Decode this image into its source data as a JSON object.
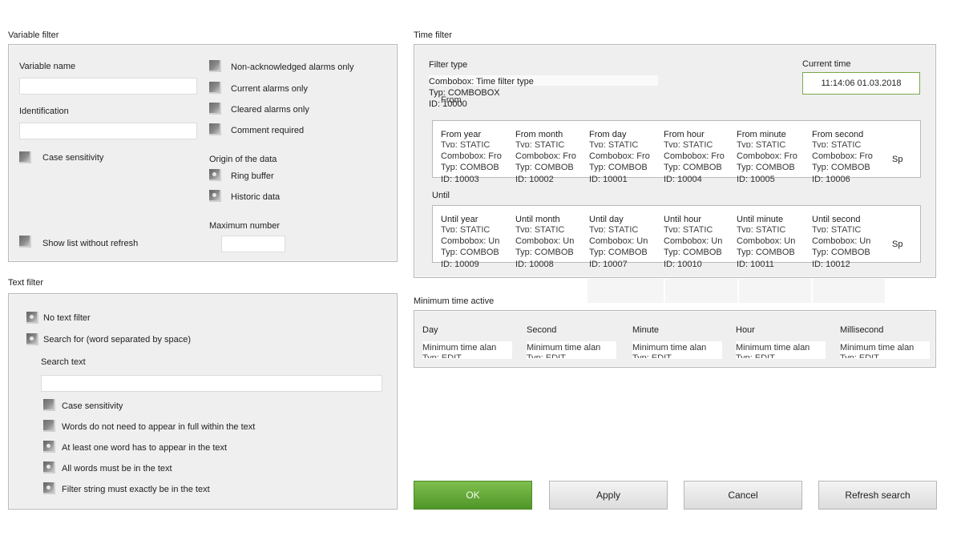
{
  "variable_filter": {
    "title": "Variable filter",
    "variable_name_label": "Variable name",
    "identification_label": "Identification",
    "case_sensitivity": "Case sensitivity",
    "non_ack": "Non-acknowledged alarms only",
    "current_alarms": "Current alarms only",
    "cleared_alarms": "Cleared alarms only",
    "comment_required": "Comment required",
    "origin_label": "Origin of the data",
    "ring_buffer": "Ring buffer",
    "historic_data": "Historic data",
    "maximum_number": "Maximum number",
    "show_list": "Show list without refresh"
  },
  "text_filter": {
    "title": "Text filter",
    "no_text_filter": "No text filter",
    "search_for": "Search for (word separated by space)",
    "search_text_label": "Search text",
    "case_sensitivity": "Case sensitivity",
    "words_not_full": "Words do not need to appear in full within the text",
    "at_least_one": "At least one word has to appear in the text",
    "all_words": "All words must be in the text",
    "exact_string": "Filter string must exactly be in the text"
  },
  "time_filter": {
    "title": "Time filter",
    "filter_type_label": "Filter type",
    "combo_line1": "Combobox: Time filter type",
    "combo_line2": "Typ: COMBOBOX",
    "combo_line3": "ID: 10000",
    "from_label": "From",
    "current_time_label": "Current time",
    "current_time_value": "11:14:06 01.03.2018",
    "until_label": "Until",
    "from_columns": [
      {
        "head": "From year",
        "combo": "Combobox: Fro",
        "typ": "Typ: COMBOB",
        "id": "ID: 10003"
      },
      {
        "head": "From month",
        "combo": "Combobox: Fro",
        "typ": "Typ: COMBOB",
        "id": "ID: 10002"
      },
      {
        "head": "From day",
        "combo": "Combobox: Fro",
        "typ": "Typ: COMBOB",
        "id": "ID: 10001"
      },
      {
        "head": "From hour",
        "combo": "Combobox: Fro",
        "typ": "Typ: COMBOB",
        "id": "ID: 10004"
      },
      {
        "head": "From minute",
        "combo": "Combobox: Fro",
        "typ": "Typ: COMBOB",
        "id": "ID: 10005"
      },
      {
        "head": "From second",
        "combo": "Combobox: Fro",
        "typ": "Typ: COMBOB",
        "id": "ID: 10006"
      }
    ],
    "until_columns": [
      {
        "head": "Until year",
        "combo": "Combobox: Un",
        "typ": "Typ: COMBOB",
        "id": "ID: 10009"
      },
      {
        "head": "Until month",
        "combo": "Combobox: Un",
        "typ": "Typ: COMBOB",
        "id": "ID: 10008"
      },
      {
        "head": "Until day",
        "combo": "Combobox: Un",
        "typ": "Typ: COMBOB",
        "id": "ID: 10007"
      },
      {
        "head": "Until hour",
        "combo": "Combobox: Un",
        "typ": "Typ: COMBOB",
        "id": "ID: 10010"
      },
      {
        "head": "Until minute",
        "combo": "Combobox: Un",
        "typ": "Typ: COMBOB",
        "id": "ID: 10011"
      },
      {
        "head": "Until second",
        "combo": "Combobox: Un",
        "typ": "Typ: COMBOB",
        "id": "ID: 10012"
      }
    ],
    "static_clip": "Typ: STATIC",
    "overflow_sp": "Sp"
  },
  "min_time": {
    "title": "Minimum time active",
    "columns": [
      {
        "head": "Day",
        "text": "Minimum time alan"
      },
      {
        "head": "Second",
        "text": "Minimum time alan"
      },
      {
        "head": "Minute",
        "text": "Minimum time alan"
      },
      {
        "head": "Hour",
        "text": "Minimum time alan"
      },
      {
        "head": "Millisecond",
        "text": "Minimum time alan"
      }
    ],
    "edit_clip": "Typ: EDIT"
  },
  "buttons": {
    "ok": "OK",
    "apply": "Apply",
    "cancel": "Cancel",
    "refresh": "Refresh search"
  },
  "colors": {
    "ok_green": "#5a9e2f",
    "current_time_border": "#7aa84a"
  }
}
